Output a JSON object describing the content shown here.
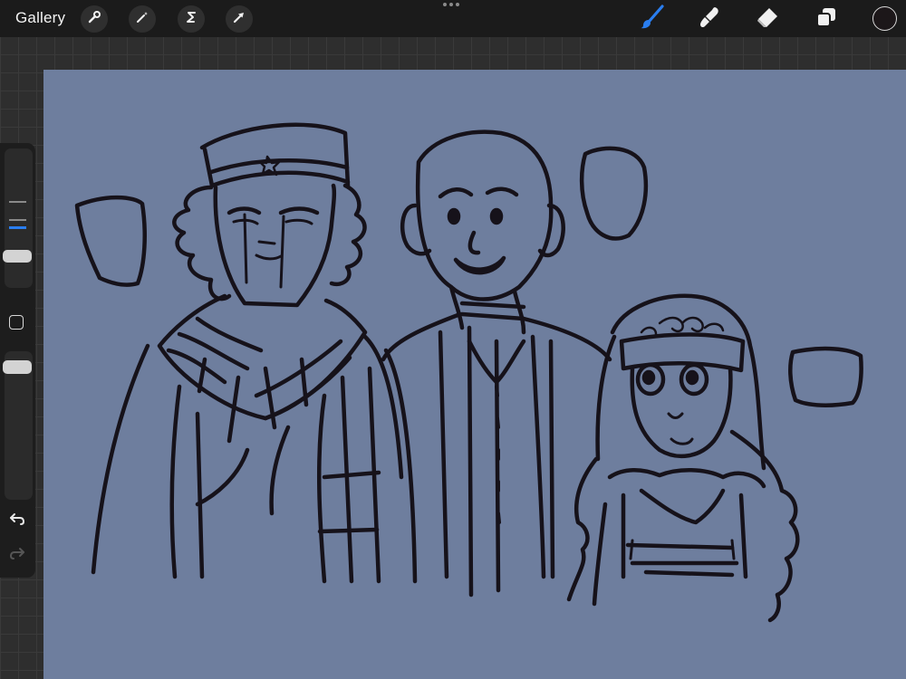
{
  "app": {
    "gallery_label": "Gallery"
  },
  "top_left_tools": [
    {
      "name": "actions",
      "icon": "wrench-icon"
    },
    {
      "name": "adjustments",
      "icon": "magic-wand-icon"
    },
    {
      "name": "selection",
      "icon": "selection-s-icon"
    },
    {
      "name": "transform",
      "icon": "arrow-cursor-icon"
    }
  ],
  "top_right_tools": [
    {
      "name": "brush",
      "icon": "brush-icon",
      "active": true
    },
    {
      "name": "smudge",
      "icon": "smudge-finger-icon",
      "active": false
    },
    {
      "name": "eraser",
      "icon": "eraser-icon",
      "active": false
    },
    {
      "name": "layers",
      "icon": "layers-icon",
      "active": false
    }
  ],
  "current_color": "#1c1719",
  "colors": {
    "canvas_background": "#6e7e9e",
    "active_tool_accent": "#2a7ef0",
    "ink": "#16121a"
  },
  "sidebar": {
    "brush_size_slider": {
      "level": 0.2
    },
    "opacity_slider": {
      "level": 0.93
    },
    "modify_button_icon": "square-icon",
    "undo_icon": "undo-icon",
    "redo_icon": "redo-icon"
  }
}
